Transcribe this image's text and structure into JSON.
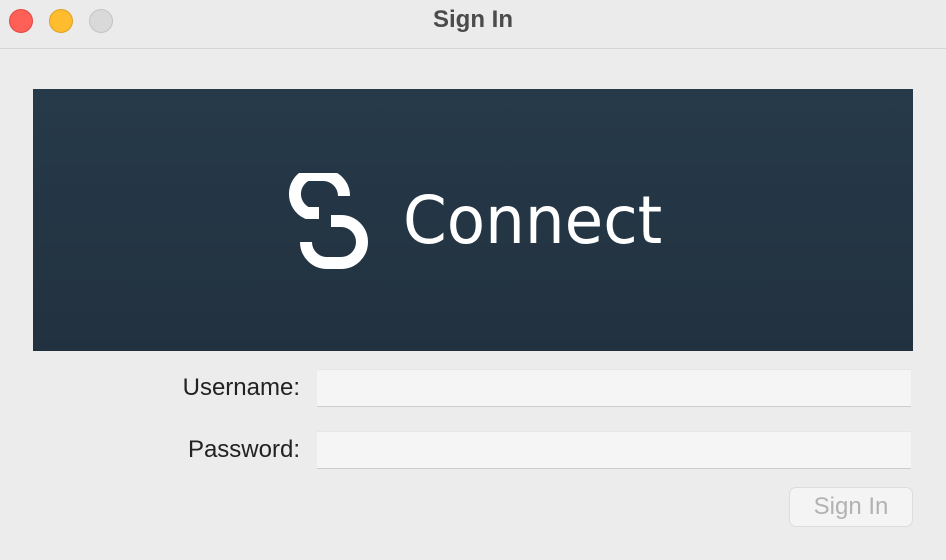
{
  "window": {
    "title": "Sign In"
  },
  "banner": {
    "brand_name": "Connect",
    "logo_icon": "connect-logo-icon",
    "background_color": "#24394a"
  },
  "form": {
    "username_label": "Username:",
    "username_value": "",
    "password_label": "Password:",
    "password_value": ""
  },
  "actions": {
    "signin_label": "Sign In",
    "signin_enabled": false
  }
}
